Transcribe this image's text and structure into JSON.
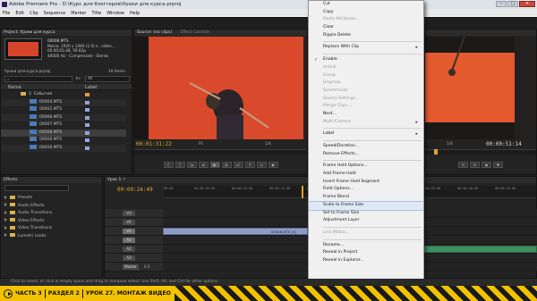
{
  "window": {
    "title": "Adobe Premiere Pro - D:\\Курс для блоггеров\\Уроки для курса.prproj",
    "min_glyph": "–",
    "max_glyph": "□",
    "close_glyph": "✕"
  },
  "menubar": [
    "File",
    "Edit",
    "Clip",
    "Sequence",
    "Marker",
    "Title",
    "Window",
    "Help"
  ],
  "project_panel": {
    "tab": "Project: Уроки для курса",
    "clip_name": "00008.MTS",
    "clip_info": [
      "Movie, 1920 x 1080 (1.0) ▾ , video...",
      "00;00;01;48, 59.83p",
      "48000 Hz - Compressed - Stereo"
    ],
    "project_file": "Уроки для курса.prproj",
    "items_count": "10 Items",
    "in_label": "In:",
    "in_value": "All",
    "col_name": "Name",
    "col_label": "Label",
    "rows": [
      {
        "name": "2. События",
        "folder": true
      },
      {
        "name": "00004.MTS"
      },
      {
        "name": "00005.MTS"
      },
      {
        "name": "00006.MTS"
      },
      {
        "name": "00007.MTS"
      },
      {
        "name": "00008.MTS"
      },
      {
        "name": "00009.MTS"
      },
      {
        "name": "00010.MTS"
      }
    ]
  },
  "source_panel": {
    "tab": "Source: (no clips)",
    "tab2": "Effect Controls",
    "timecode": "00:01:31:22",
    "fit": "Fit",
    "page": "1/4"
  },
  "program_panel": {
    "timecode_left": "00:01:31:22",
    "timecode_right": "00:00:51:14",
    "page": "1/4"
  },
  "effects_panel": {
    "tab": "Effects",
    "items": [
      "Presets",
      "Audio Effects",
      "Audio Transitions",
      "Video Effects",
      "Video Transitions",
      "Lumetri Looks"
    ]
  },
  "timeline": {
    "tab": "Урок 1",
    "timecode": "00:00:24:49",
    "ticks": [
      "00:00",
      "00:00:05:00",
      "00:00:10:00",
      "00:00:15:00",
      "00:00:20:00",
      "00:00:25:00",
      "00:00:30:00",
      "00:00:35:00",
      "00:00:40:00",
      "00:00:45:00"
    ],
    "tracks": [
      {
        "name": "V3",
        "type": "video"
      },
      {
        "name": "V2",
        "type": "video"
      },
      {
        "name": "V1",
        "type": "video",
        "clip": "00008.MTS [V]"
      },
      {
        "name": "A1",
        "type": "audio"
      },
      {
        "name": "A2",
        "type": "audio"
      },
      {
        "name": "A3",
        "type": "audio"
      },
      {
        "name": "Master",
        "type": "master",
        "value": "0.0"
      }
    ]
  },
  "context_menu": {
    "items": [
      {
        "label": "Cut",
        "state": "normal"
      },
      {
        "label": "Copy",
        "state": "normal"
      },
      {
        "label": "Paste Attributes...",
        "state": "disabled"
      },
      {
        "label": "Clear",
        "state": "normal"
      },
      {
        "label": "Ripple Delete",
        "state": "normal"
      },
      {
        "sep": true
      },
      {
        "label": "Replace With Clip",
        "state": "normal",
        "sub": true
      },
      {
        "sep": true
      },
      {
        "label": "Enable",
        "state": "checked"
      },
      {
        "label": "Unlink",
        "state": "disabled"
      },
      {
        "label": "Group",
        "state": "disabled"
      },
      {
        "label": "Ungroup",
        "state": "disabled"
      },
      {
        "label": "Synchronize",
        "state": "disabled"
      },
      {
        "label": "Source Settings...",
        "state": "disabled"
      },
      {
        "label": "Merge Clips...",
        "state": "disabled"
      },
      {
        "label": "Nest...",
        "state": "normal"
      },
      {
        "label": "Multi-Camera",
        "state": "disabled",
        "sub": true
      },
      {
        "sep": true
      },
      {
        "label": "Label",
        "state": "normal",
        "sub": true
      },
      {
        "sep": true
      },
      {
        "label": "Speed/Duration...",
        "state": "normal"
      },
      {
        "label": "Remove Effects...",
        "state": "normal"
      },
      {
        "sep": true
      },
      {
        "label": "Frame Hold Options...",
        "state": "normal"
      },
      {
        "label": "Add Frame Hold",
        "state": "normal"
      },
      {
        "label": "Insert Frame Hold Segment",
        "state": "normal"
      },
      {
        "label": "Field Options...",
        "state": "normal"
      },
      {
        "label": "Frame Blend",
        "state": "normal"
      },
      {
        "label": "Scale to Frame Size",
        "state": "highlight"
      },
      {
        "label": "Set to Frame Size",
        "state": "normal"
      },
      {
        "label": "Adjustment Layer",
        "state": "normal"
      },
      {
        "sep": true
      },
      {
        "label": "Link Media...",
        "state": "disabled"
      },
      {
        "sep": true
      },
      {
        "label": "Rename...",
        "state": "normal"
      },
      {
        "label": "Reveal in Project",
        "state": "normal"
      },
      {
        "label": "Reveal in Explorer...",
        "state": "normal"
      }
    ]
  },
  "status_bar": "Click to select, or click in empty space and drag to marquee select. Use Shift, Alt, and Ctrl for other options.",
  "banner": {
    "part1": "ЧАСТЬ 3",
    "part2": "РАЗДЕЛ 2",
    "part3": "УРОК 27. МОНТАЖ ВИДЕО"
  }
}
